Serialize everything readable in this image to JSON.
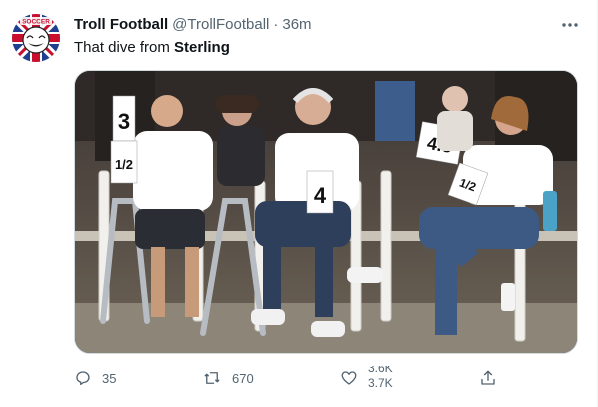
{
  "tweet": {
    "author": {
      "display_name": "Troll Football",
      "handle": "@TrollFootball",
      "avatar_icon": "troll-face-union-jack-avatar",
      "avatar_text": "SOCCER"
    },
    "separator": "·",
    "timestamp": "36m",
    "text_prefix": "That dive from ",
    "text_bold": "Sterling",
    "more_icon": "ellipsis-icon",
    "media": {
      "description_icon": "photo",
      "scorecards": {
        "left_top": "3",
        "left_bottom": "1/2",
        "center": "4",
        "right_top": "4.5",
        "right_bottom": "1/2"
      }
    },
    "actions": {
      "reply": {
        "icon": "reply-icon",
        "count": "35"
      },
      "retweet": {
        "icon": "retweet-icon",
        "count": "670"
      },
      "like": {
        "icon": "heart-icon",
        "count_old": "3.6K",
        "count_new": "3.7K"
      },
      "share": {
        "icon": "share-icon"
      }
    },
    "colors": {
      "text_primary": "#0f1419",
      "text_secondary": "#536471",
      "border": "#cfd9de"
    }
  }
}
